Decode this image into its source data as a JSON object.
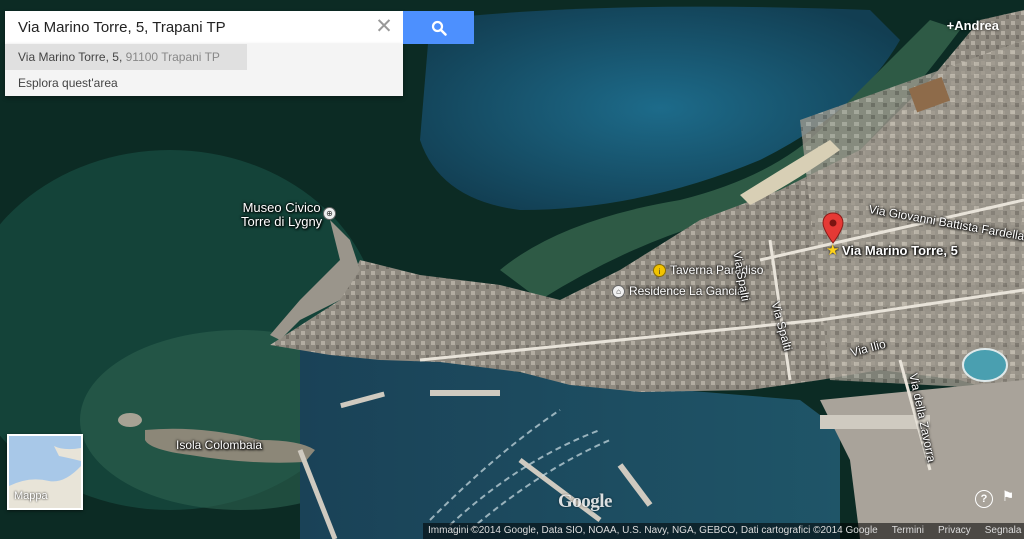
{
  "search": {
    "value": "Via Marino Torre, 5, Trapani TP",
    "clear_icon": "close-icon",
    "button_icon": "search-icon",
    "button_color": "#4d90fe"
  },
  "suggestions": [
    {
      "main": "Via Marino Torre, 5,",
      "sub": " 91100 Trapani TP"
    },
    {
      "main": "Esplora quest'area",
      "sub": ""
    }
  ],
  "user": {
    "name": "+Andrea"
  },
  "map_labels": {
    "museum": "Museo Civico\nTorre di Lygny",
    "isola": "Isola Colombaia",
    "taverna": "Taverna Paradiso",
    "residence": "Residence La Gancia",
    "pin_label": "Via Marino Torre, 5",
    "via_giovanni": "Via Giovanni Battista Fardella",
    "via_spalti_1": "Via Spalti",
    "via_spalti_2": "Via Spalti",
    "via_ilio": "Via Ilio",
    "via_zavorra": "Via della Zavorra"
  },
  "mini_map": {
    "label": "Mappa"
  },
  "logo": "Google",
  "footer": {
    "attribution": "Immagini ©2014 Google, Data SIO, NOAA, U.S. Navy, NGA, GEBCO, Dati cartografici ©2014 Google",
    "terms": "Termini",
    "privacy": "Privacy",
    "report": "Segnala un problema"
  },
  "colors": {
    "pin": "#e53935",
    "sea_deep": "#0b2a22",
    "sea_shallow": "#2a6a6a"
  }
}
